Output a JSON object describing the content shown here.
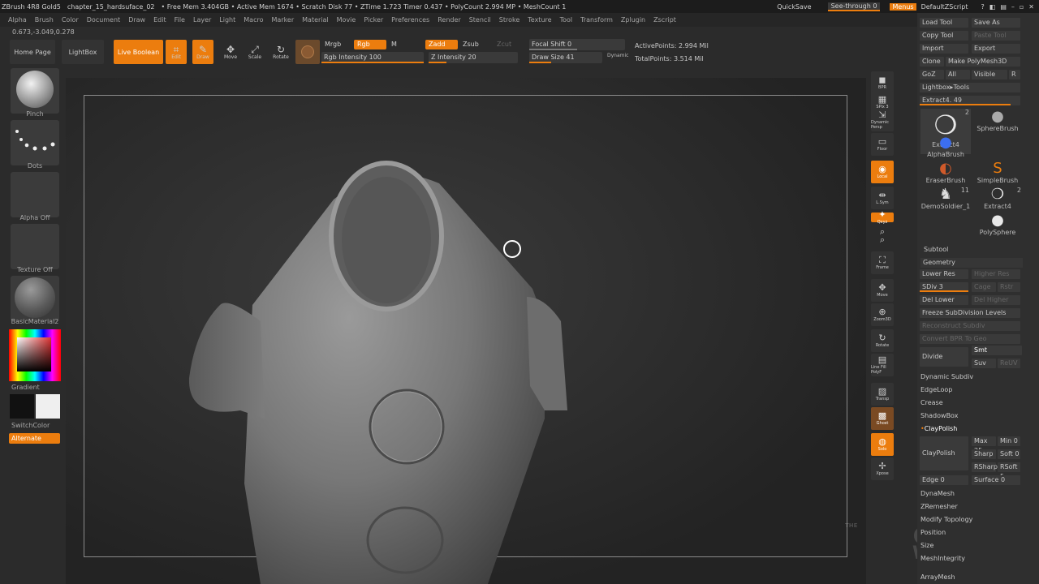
{
  "titlebar": {
    "app": "ZBrush 4R8 Gold5",
    "doc": "chapter_15_hardsuface_02",
    "stats": "• Free Mem 3.404GB • Active Mem 1674 • Scratch Disk 77 • ZTime 1.723 Timer 0.437 • PolyCount 2.994 MP • MeshCount 1",
    "quicksave": "QuickSave",
    "seethrough": "See-through  0",
    "menus": "Menus",
    "script": "DefaultZScript"
  },
  "menubar": [
    "Alpha",
    "Brush",
    "Color",
    "Document",
    "Draw",
    "Edit",
    "File",
    "Layer",
    "Light",
    "Macro",
    "Marker",
    "Material",
    "Movie",
    "Picker",
    "Preferences",
    "Render",
    "Stencil",
    "Stroke",
    "Texture",
    "Tool",
    "Transform",
    "Zplugin",
    "Zscript"
  ],
  "coords": "0.673,-3.049,0.278",
  "shelf": {
    "home_page": "Home Page",
    "lightbox": "LightBox",
    "live_boolean": "Live Boolean",
    "edit": "Edit",
    "draw": "Draw",
    "move": "Move",
    "scale": "Scale",
    "rotate": "Rotate",
    "mrgb": "Mrgb",
    "rgb": "Rgb",
    "m": "M",
    "rgb_intensity": "Rgb Intensity 100",
    "zadd": "Zadd",
    "zsub": "Zsub",
    "zcut": "Zcut",
    "z_intensity": "Z Intensity 20",
    "focal_shift": "Focal Shift 0",
    "draw_size": "Draw Size 41",
    "dynamic": "Dynamic",
    "active_points": "ActivePoints: 2.994 Mil",
    "total_points": "TotalPoints: 3.514 Mil"
  },
  "left": {
    "pinch": "Pinch",
    "dots": "Dots",
    "alpha_off": "Alpha Off",
    "texture_off": "Texture Off",
    "material": "BasicMaterial2",
    "gradient": "Gradient",
    "switch_color": "SwitchColor",
    "alternate": "Alternate"
  },
  "right_strip": [
    "BPR",
    "SPix 3",
    "Dynamic Persp",
    "Floor",
    "Local",
    "L.Sym",
    "Qxyz",
    "",
    "",
    "Frame",
    "Move",
    "Zoom3D",
    "Rotate",
    "Line Fill PolyF",
    "Transp",
    "Ghost",
    "Solo",
    "Xpose"
  ],
  "tool": {
    "load_tool": "Load Tool",
    "save_as": "Save As",
    "copy_tool": "Copy Tool",
    "paste_tool": "Paste Tool",
    "import": "Import",
    "export": "Export",
    "clone": "Clone",
    "make_polymesh": "Make PolyMesh3D",
    "goz": "GoZ",
    "all": "All",
    "visible": "Visible",
    "r": "R",
    "lightbox_tools": "Lightbox▸Tools",
    "extract_slider": "Extract4. 49",
    "brushes": [
      {
        "name": "Extract4",
        "count": "2"
      },
      {
        "name": "SphereBrush",
        "count": ""
      },
      {
        "name": "AlphaBrush",
        "count": ""
      },
      {
        "name": "SimpleBrush",
        "count": ""
      },
      {
        "name": "EraserBrush",
        "count": ""
      },
      {
        "name": "Extract4",
        "count": "2"
      },
      {
        "name": "DemoSoldier_1",
        "count": "11"
      },
      {
        "name": "PolySphere",
        "count": ""
      }
    ],
    "subtool": "Subtool",
    "geometry": "Geometry",
    "lower_res": "Lower Res",
    "higher_res": "Higher Res",
    "sdiv": "SDiv 3",
    "cage": "Cage",
    "rstr": "Rstr",
    "del_lower": "Del Lower",
    "del_higher": "Del Higher",
    "freeze": "Freeze SubDivision Levels",
    "reconstruct": "Reconstruct Subdiv",
    "convert_bpr": "Convert BPR To Geo",
    "divide": "Divide",
    "smt": "Smt",
    "suv": "Suv",
    "reuv": "ReUV",
    "dynamic_subdiv": "Dynamic Subdiv",
    "edgeloop": "EdgeLoop",
    "crease": "Crease",
    "shadowbox": "ShadowBox",
    "claypolish": "ClayPolish",
    "claypolish_btn": "ClayPolish",
    "max": "Max 25",
    "min": "Min 0",
    "sharp": "Sharp",
    "soft": "Soft 0",
    "rsharp": "RSharp",
    "rsoft": "RSoft 5",
    "edge": "Edge 0",
    "surface": "Surface 0",
    "dynamesh": "DynaMesh",
    "zremesher": "ZRemesher",
    "modify_topology": "Modify Topology",
    "position": "Position",
    "size": "Size",
    "meshintegrity": "MeshIntegrity",
    "arraymesh": "ArrayMesh"
  },
  "watermark": {
    "line1": "GNOMON",
    "line2": "WORKSHOP",
    "the": "THE"
  }
}
